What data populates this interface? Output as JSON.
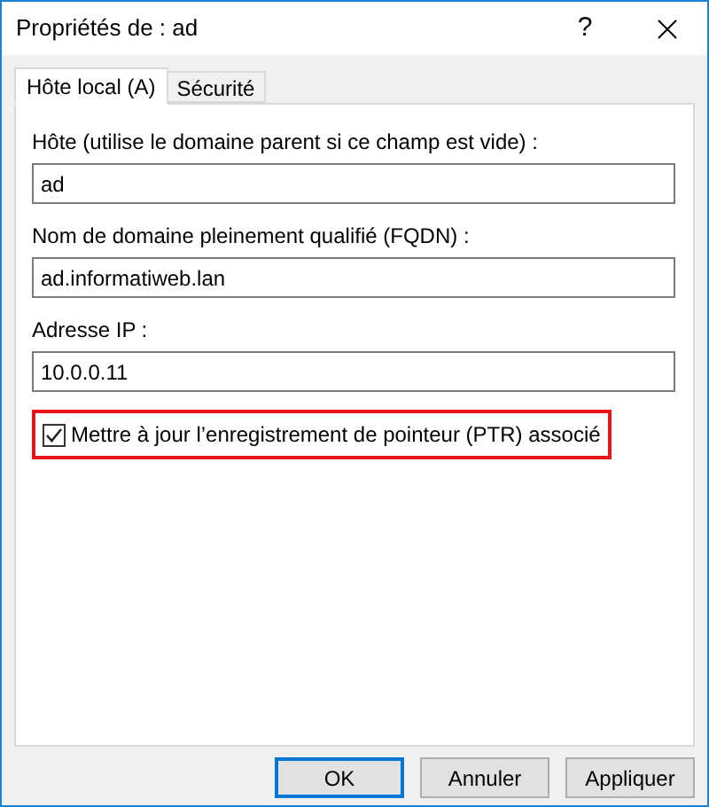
{
  "window": {
    "title": "Propriétés de : ad",
    "help": "?"
  },
  "tabs": [
    {
      "label": "Hôte local (A)",
      "selected": true
    },
    {
      "label": "Sécurité",
      "selected": false
    }
  ],
  "fields": [
    {
      "label": "Hôte (utilise le domaine parent si ce champ est vide) :",
      "value": "ad"
    },
    {
      "label": "Nom de domaine pleinement qualifié (FQDN) :",
      "value": "ad.informatiweb.lan"
    },
    {
      "label": "Adresse IP :",
      "value": "10.0.0.11"
    }
  ],
  "checkbox": {
    "label": "Mettre à jour l’enregistrement de pointeur (PTR) associé",
    "checked": true,
    "highlighted": true
  },
  "buttons": [
    {
      "label": "OK",
      "default": true
    },
    {
      "label": "Annuler",
      "default": false
    },
    {
      "label": "Appliquer",
      "default": false
    }
  ]
}
